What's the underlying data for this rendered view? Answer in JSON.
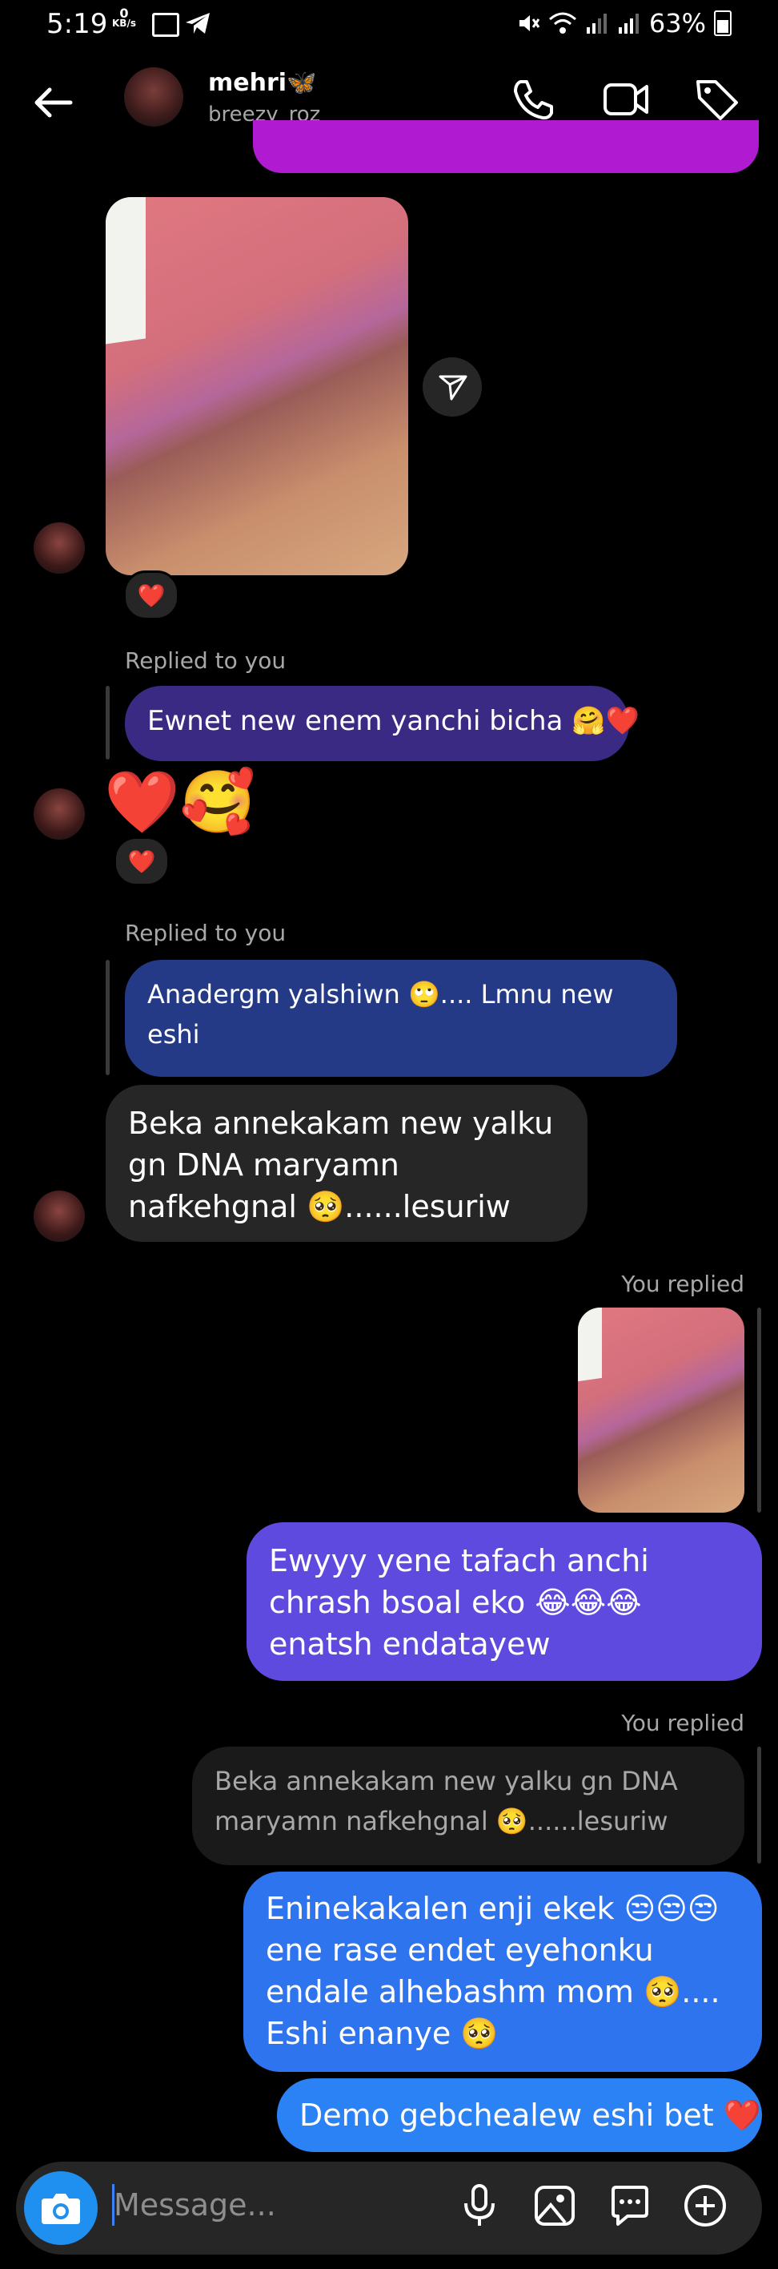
{
  "status_bar": {
    "time": "5:19",
    "net_speed": "0",
    "net_unit": "KB/s",
    "battery": "63%"
  },
  "header": {
    "name": "mehri🦋",
    "username": "breezy_roz"
  },
  "messages": {
    "reaction_1": "❤️",
    "replied_label_1": "Replied to you",
    "reply_quote_1": "Ewnet new enem yanchi bicha 🤗❤️",
    "emoji_msg": "❤️🥰",
    "reaction_2": "❤️",
    "replied_label_2": "Replied to you",
    "reply_quote_2": "Anadergm yalshiwn 🙄.... Lmnu new eshi",
    "incoming_1": "Beka annekakam new yalku gn DNA maryamn nafkehgnal 🥺......lesuriw",
    "you_replied_1": "You replied",
    "outgoing_1": "Ewyyy yene tafach anchi chrash bsoal eko 😂😂😂 enatsh endatayew",
    "you_replied_2": "You replied",
    "quoted_2": "Beka annekakam new yalku gn DNA maryamn nafkehgnal 🥺......lesuriw",
    "outgoing_2": "Eninekakalen enji ekek 😒😒😒 ene rase endet eyehonku endale alhebashm mom 🥺.... Eshi enanye 🥺",
    "outgoing_3": "Demo gebchealew eshi bet ❤️"
  },
  "composer": {
    "placeholder": "Message..."
  },
  "colors": {
    "accent_purple": "#b01bd1",
    "bubble_reply_1": "#3a2a83",
    "bubble_reply_2": "#243a86",
    "incoming_bg": "#262626",
    "outgoing_1": "#5f4ae0",
    "outgoing_2": "#2f74ef",
    "outgoing_3": "#2a82f5"
  }
}
